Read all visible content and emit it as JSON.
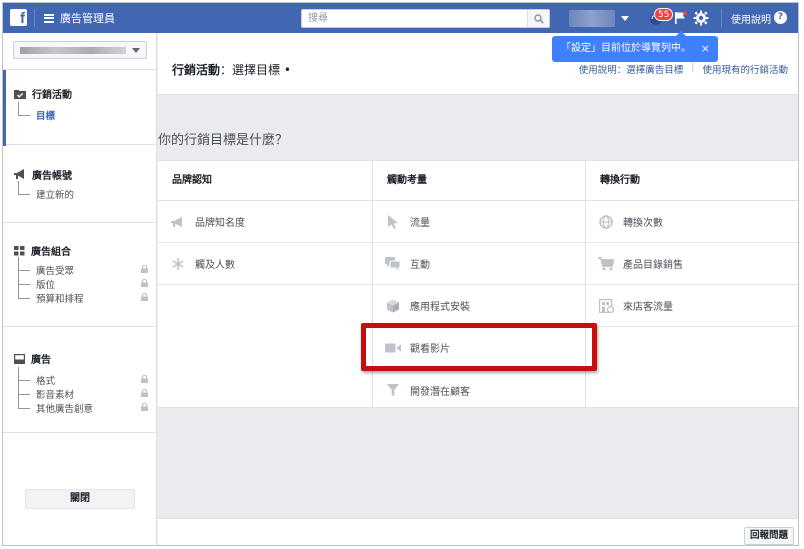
{
  "topbar": {
    "logo": "f",
    "menu_label": "廣告管理員",
    "search_placeholder": "搜尋",
    "notification_count": "55",
    "help_label": "使用說明",
    "help_q": "?"
  },
  "tooltip": {
    "text": "「設定」目前位於導覽列中。",
    "close": "×"
  },
  "sidebar": {
    "sections": [
      {
        "title": "行銷活動",
        "items": [
          {
            "label": "目標"
          }
        ]
      },
      {
        "title": "廣告帳號",
        "items": [
          {
            "label": "建立新的"
          }
        ]
      },
      {
        "title": "廣告組合",
        "items": [
          {
            "label": "廣告受眾"
          },
          {
            "label": "版位"
          },
          {
            "label": "預算和排程"
          }
        ]
      },
      {
        "title": "廣告",
        "items": [
          {
            "label": "格式"
          },
          {
            "label": "影音素材"
          },
          {
            "label": "其他廣告創意"
          }
        ]
      }
    ],
    "close_label": "關閉"
  },
  "main": {
    "title_bold": "行銷活動",
    "title_rest": "：選擇目標 •",
    "link_help": "使用說明：選擇廣告目標",
    "link_existing": "使用現有的行銷活動",
    "question": "你的行銷目標是什麼？",
    "columns": [
      {
        "header": "品牌認知",
        "items": [
          {
            "label": "品牌知名度",
            "icon": "megaphone-icon"
          },
          {
            "label": "觸及人數",
            "icon": "snowflake-icon"
          }
        ]
      },
      {
        "header": "觸動考量",
        "items": [
          {
            "label": "流量",
            "icon": "cursor-icon"
          },
          {
            "label": "互動",
            "icon": "chat-bubbles-icon"
          },
          {
            "label": "應用程式安裝",
            "icon": "cube-icon"
          },
          {
            "label": "觀看影片",
            "icon": "video-camera-icon"
          },
          {
            "label": "開發潛在顧客",
            "icon": "funnel-icon"
          }
        ]
      },
      {
        "header": "轉換行動",
        "items": [
          {
            "label": "轉換次數",
            "icon": "globe-icon"
          },
          {
            "label": "產品目錄銷售",
            "icon": "shopping-cart-icon"
          },
          {
            "label": "來店客流量",
            "icon": "store-icon"
          }
        ]
      }
    ]
  },
  "footer": {
    "report_label": "回報問題"
  },
  "colors": {
    "brand": "#4267b2",
    "highlight": "#c80d0d",
    "tooltip": "#4080ff",
    "badge": "#fa3e3e"
  }
}
